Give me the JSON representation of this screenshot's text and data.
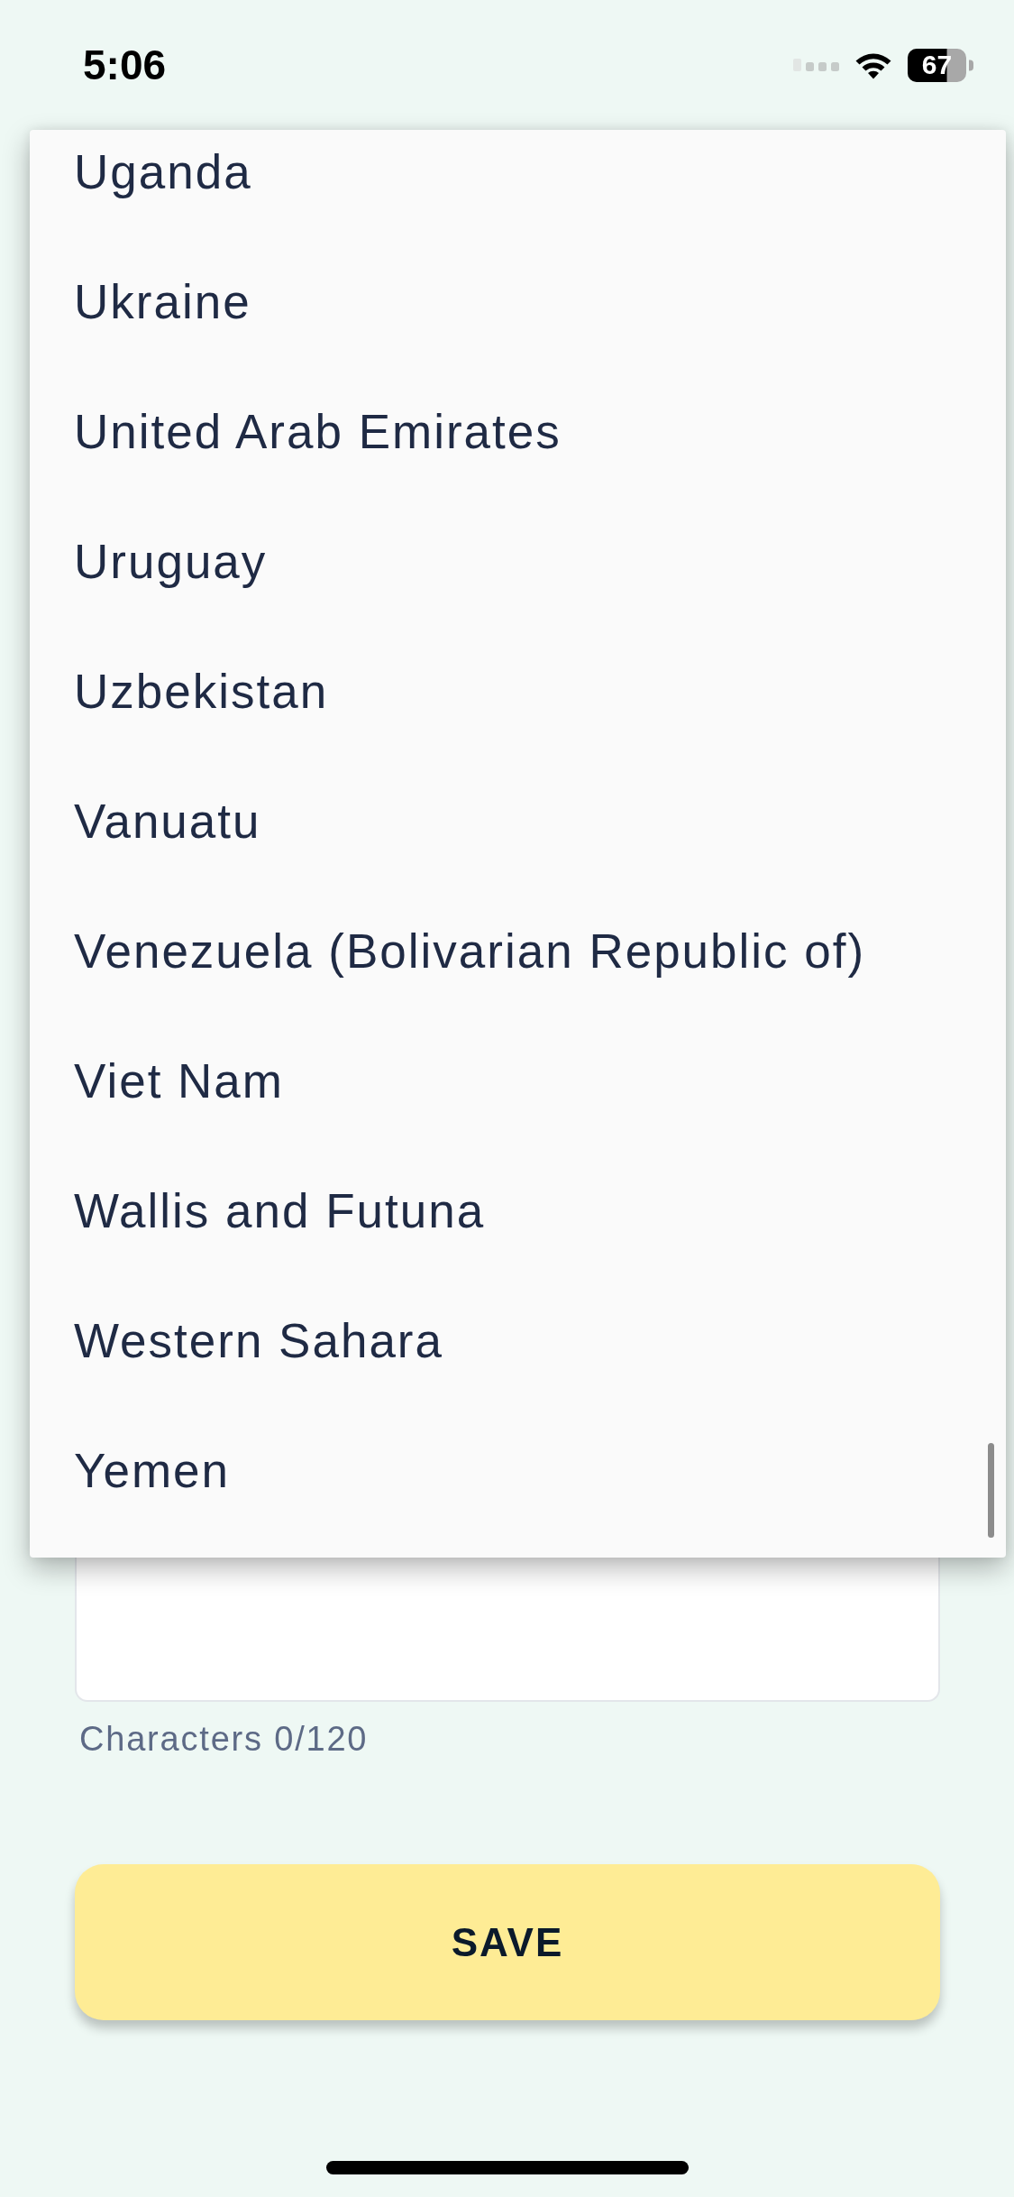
{
  "status_bar": {
    "time": "5:06",
    "battery": "67"
  },
  "dropdown": {
    "options": [
      {
        "label": "Uganda",
        "selected": false
      },
      {
        "label": "Ukraine",
        "selected": false
      },
      {
        "label": "United Arab Emirates",
        "selected": false
      },
      {
        "label": "Uruguay",
        "selected": false
      },
      {
        "label": "Uzbekistan",
        "selected": false
      },
      {
        "label": "Vanuatu",
        "selected": false
      },
      {
        "label": "Venezuela (Bolivarian Republic of)",
        "selected": false
      },
      {
        "label": "Viet Nam",
        "selected": false
      },
      {
        "label": "Wallis and Futuna",
        "selected": false
      },
      {
        "label": "Western Sahara",
        "selected": false
      },
      {
        "label": "Yemen",
        "selected": false
      }
    ]
  },
  "form": {
    "character_count": "Characters 0/120",
    "save_button": "SAVE"
  }
}
